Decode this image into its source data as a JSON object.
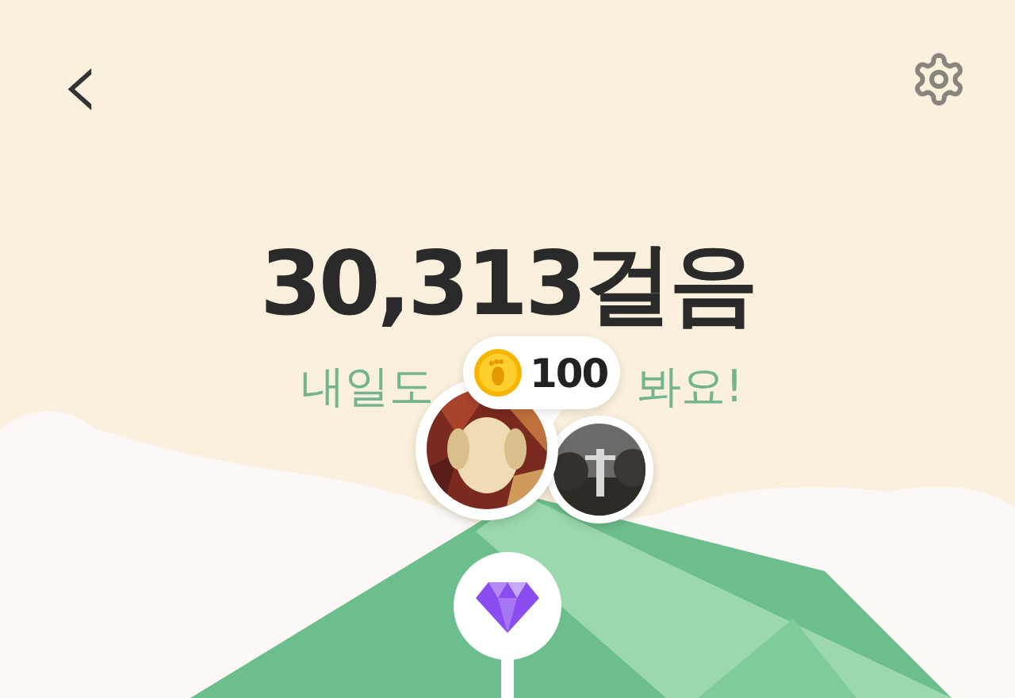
{
  "header": {
    "back": "‹"
  },
  "steps": "30,313걸음",
  "message": {
    "start": "내일도",
    "end": "봐요!"
  },
  "reward": {
    "amount": "100"
  }
}
